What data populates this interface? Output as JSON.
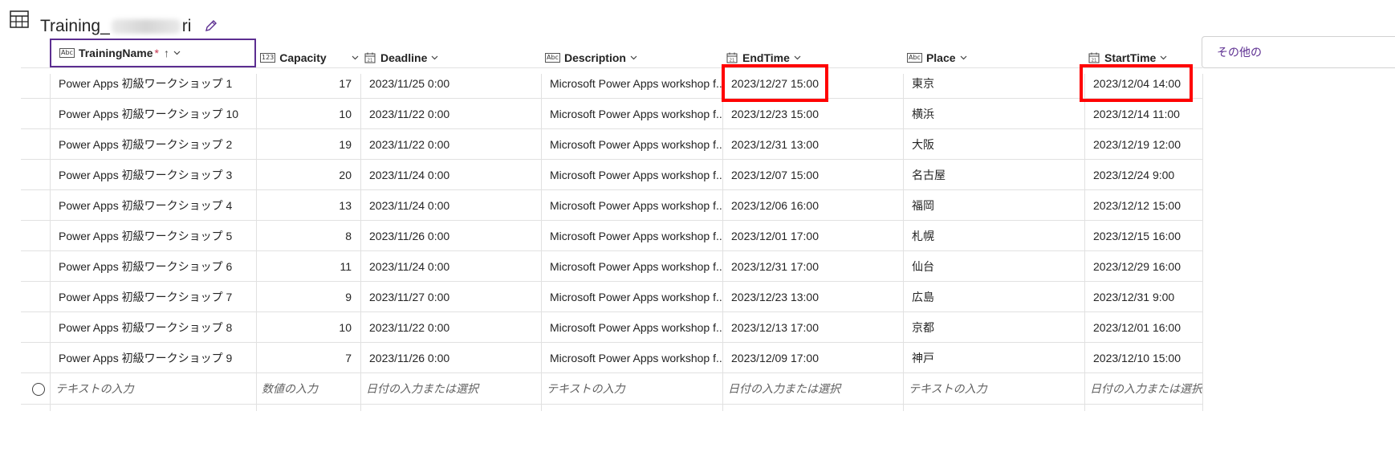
{
  "title": {
    "prefix": "Training_",
    "suffix": "ri"
  },
  "columns": [
    {
      "label": "TrainingName",
      "type": "text",
      "required": "*",
      "sort": "↑"
    },
    {
      "label": "Capacity",
      "type": "number"
    },
    {
      "label": "Deadline",
      "type": "date"
    },
    {
      "label": "Description",
      "type": "text"
    },
    {
      "label": "EndTime",
      "type": "date"
    },
    {
      "label": "Place",
      "type": "text"
    },
    {
      "label": "StartTime",
      "type": "date"
    }
  ],
  "more_columns_label": "その他の",
  "rows": [
    [
      "Power Apps 初級ワークショップ 1",
      "17",
      "2023/11/25 0:00",
      "Microsoft Power Apps workshop f...",
      "2023/12/27 15:00",
      "東京",
      "2023/12/04 14:00"
    ],
    [
      "Power Apps 初級ワークショップ 10",
      "10",
      "2023/11/22 0:00",
      "Microsoft Power Apps workshop f...",
      "2023/12/23 15:00",
      "横浜",
      "2023/12/14 11:00"
    ],
    [
      "Power Apps 初級ワークショップ 2",
      "19",
      "2023/11/22 0:00",
      "Microsoft Power Apps workshop f...",
      "2023/12/31 13:00",
      "大阪",
      "2023/12/19 12:00"
    ],
    [
      "Power Apps 初級ワークショップ 3",
      "20",
      "2023/11/24 0:00",
      "Microsoft Power Apps workshop f...",
      "2023/12/07 15:00",
      "名古屋",
      "2023/12/24 9:00"
    ],
    [
      "Power Apps 初級ワークショップ 4",
      "13",
      "2023/11/24 0:00",
      "Microsoft Power Apps workshop f...",
      "2023/12/06 16:00",
      "福岡",
      "2023/12/12 15:00"
    ],
    [
      "Power Apps 初級ワークショップ 5",
      "8",
      "2023/11/26 0:00",
      "Microsoft Power Apps workshop f...",
      "2023/12/01 17:00",
      "札幌",
      "2023/12/15 16:00"
    ],
    [
      "Power Apps 初級ワークショップ 6",
      "11",
      "2023/11/24 0:00",
      "Microsoft Power Apps workshop f...",
      "2023/12/31 17:00",
      "仙台",
      "2023/12/29 16:00"
    ],
    [
      "Power Apps 初級ワークショップ 7",
      "9",
      "2023/11/27 0:00",
      "Microsoft Power Apps workshop f...",
      "2023/12/23 13:00",
      "広島",
      "2023/12/31 9:00"
    ],
    [
      "Power Apps 初級ワークショップ 8",
      "10",
      "2023/11/22 0:00",
      "Microsoft Power Apps workshop f...",
      "2023/12/13 17:00",
      "京都",
      "2023/12/01 16:00"
    ],
    [
      "Power Apps 初級ワークショップ 9",
      "7",
      "2023/11/26 0:00",
      "Microsoft Power Apps workshop f...",
      "2023/12/09 17:00",
      "神戸",
      "2023/12/10 15:00"
    ]
  ],
  "new_row_placeholders": [
    "テキストの入力",
    "数値の入力",
    "日付の入力または選択",
    "テキストの入力",
    "日付の入力または選択",
    "テキストの入力",
    "日付の入力または選択"
  ],
  "icons": {
    "title": "table-grid-icon",
    "edit": "pencil-icon",
    "text_column": "abc-icon",
    "number_column": "123-icon",
    "date_column": "calendar-icon",
    "menu": "chevron-down-icon"
  },
  "colors": {
    "accent": "#5c2e91",
    "highlight": "#ff0000"
  }
}
